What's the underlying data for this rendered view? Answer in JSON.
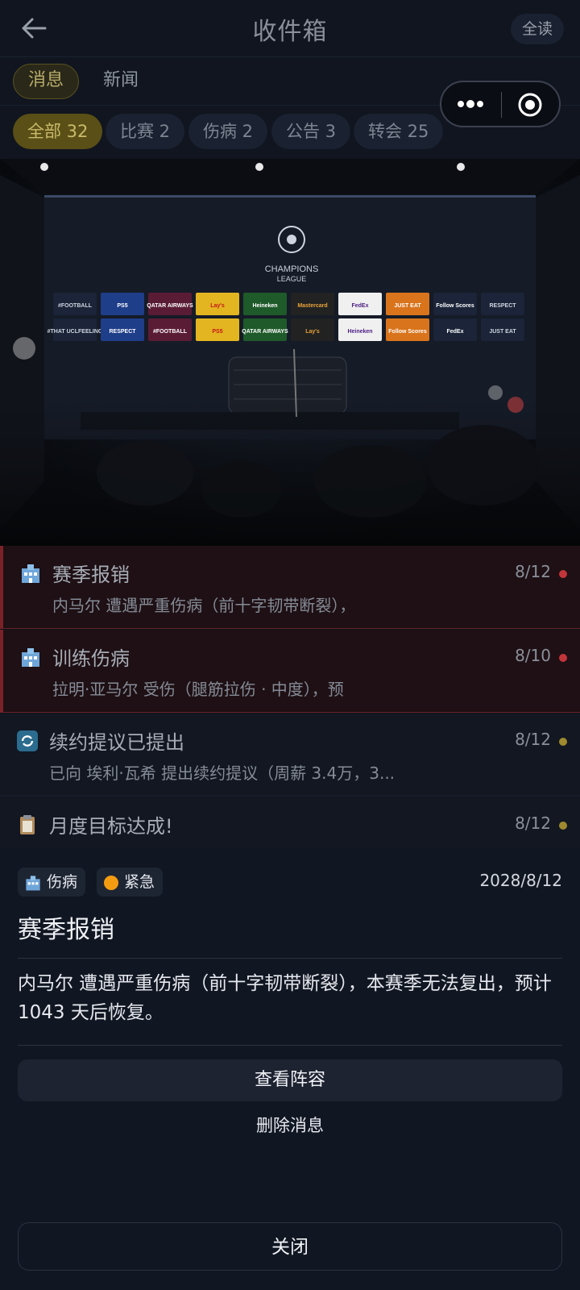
{
  "header": {
    "title": "收件箱",
    "read_all_label": "全读"
  },
  "tabs": [
    {
      "label": "消息",
      "active": true
    },
    {
      "label": "新闻",
      "active": false
    }
  ],
  "filters": [
    {
      "label": "全部 32",
      "active": true
    },
    {
      "label": "比赛 2",
      "active": false
    },
    {
      "label": "伤病 2",
      "active": false
    },
    {
      "label": "公告 3",
      "active": false
    },
    {
      "label": "转会 25",
      "active": false
    }
  ],
  "hero": {
    "league_name": "CHAMPIONS",
    "league_sub": "LEAGUE",
    "sponsors_row1": [
      "#FOOTBALL",
      "PS5",
      "QATAR AIRWAYS",
      "Lay's",
      "Heineken",
      "Mastercard",
      "FedEx",
      "JUST EAT",
      "Follow Scores",
      "RESPECT"
    ],
    "sponsors_row2": [
      "#THAT UCLFEELING",
      "RESPECT",
      "#FOOTBALL",
      "PS5",
      "QATAR AIRWAYS",
      "Lay's",
      "Heineken",
      "Follow Scores",
      "FedEx",
      "JUST EAT"
    ]
  },
  "messages": [
    {
      "title": "赛季报销",
      "preview": "内马尔 遭遇严重伤病（前十字韧带断裂），",
      "date": "8/12",
      "urgent": true,
      "dot_color": "#c2353b",
      "icon": "hospital-icon"
    },
    {
      "title": "训练伤病",
      "preview": "拉明·亚马尔 受伤（腿筋拉伤 · 中度），预",
      "date": "8/10",
      "urgent": true,
      "dot_color": "#c2353b",
      "icon": "hospital-icon"
    },
    {
      "title": "续约提议已提出",
      "preview": "已向 埃利·瓦希 提出续约提议（周薪 3.4万，3...",
      "date": "8/12",
      "urgent": false,
      "dot_color": "#a08a2e",
      "icon": "refresh-icon"
    },
    {
      "title": "月度目标达成!",
      "preview": "",
      "date": "8/12",
      "urgent": false,
      "dot_color": "#a08a2e",
      "icon": "clipboard-icon"
    }
  ],
  "detail": {
    "category_badge": "伤病",
    "priority_badge": "紧急",
    "date": "2028/8/12",
    "title": "赛季报销",
    "body": "内马尔 遭遇严重伤病（前十字韧带断裂），本赛季无法复出，预计 1043 天后恢复。",
    "primary_button": "查看阵容",
    "delete_button": "删除消息",
    "close_button": "关闭",
    "accent_orange": "#f39c12"
  }
}
